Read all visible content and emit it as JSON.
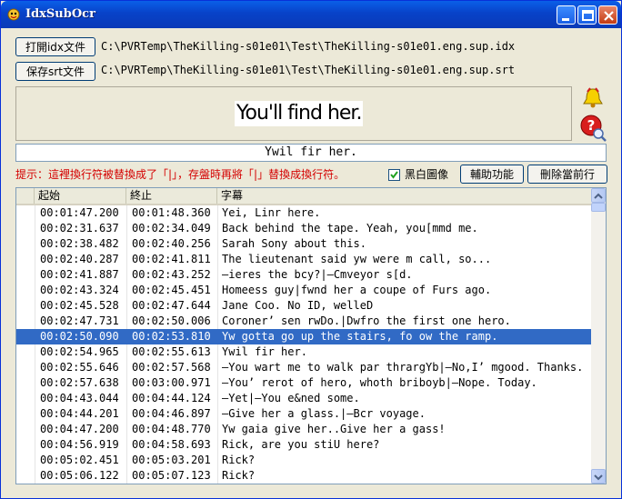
{
  "window": {
    "title": "IdxSubOcr"
  },
  "toolbar": {
    "open_idx_label": "打開idx文件",
    "idx_path": "C:\\PVRTemp\\TheKilling-s01e01\\Test\\TheKilling-s01e01.eng.sup.idx",
    "save_srt_label": "保存srt文件",
    "srt_path": "C:\\PVRTemp\\TheKilling-s01e01\\Test\\TheKilling-s01e01.eng.sup.srt"
  },
  "preview": {
    "image_text": "You'll find her."
  },
  "ocr": {
    "current_text": "Ywil fir her."
  },
  "hint": {
    "text": "提示：這裡換行符被替換成了「|」，存盤時再將「|」替換成換行符。"
  },
  "options": {
    "bw_image_label": "黑白圖像",
    "bw_checked": true
  },
  "actions": {
    "assist_label": "輔助功能",
    "delete_label": "刪除當前行"
  },
  "table": {
    "columns": [
      "起始",
      "終止",
      "字幕"
    ],
    "selected_index": 8,
    "rows": [
      {
        "start": "00:01:47.200",
        "end": "00:01:48.360",
        "text": "Yei, Linr here."
      },
      {
        "start": "00:02:31.637",
        "end": "00:02:34.049",
        "text": "Back behind the tape. Yeah, you[mmd me."
      },
      {
        "start": "00:02:38.482",
        "end": "00:02:40.256",
        "text": "Sarah Sony about this."
      },
      {
        "start": "00:02:40.287",
        "end": "00:02:41.811",
        "text": "The lieutenant said yw were m call, so..."
      },
      {
        "start": "00:02:41.887",
        "end": "00:02:43.252",
        "text": "—ieres the bcy?|—Cmveyor s[d."
      },
      {
        "start": "00:02:43.324",
        "end": "00:02:45.451",
        "text": "Homeess guy|fwnd her a coupe of Furs ago."
      },
      {
        "start": "00:02:45.528",
        "end": "00:02:47.644",
        "text": "Jane Coo. No ID, welleD"
      },
      {
        "start": "00:02:47.731",
        "end": "00:02:50.006",
        "text": "Coroner’ sen rwDo.|Dwfro the first one hero."
      },
      {
        "start": "00:02:50.090",
        "end": "00:02:53.810",
        "text": "Yw gotta go up the stairs, fo ow the ramp."
      },
      {
        "start": "00:02:54.965",
        "end": "00:02:55.613",
        "text": "Ywil fir her."
      },
      {
        "start": "00:02:55.646",
        "end": "00:02:57.568",
        "text": "—You wart me to walk par thrargYb|—No,I’ mgood. Thanks."
      },
      {
        "start": "00:02:57.638",
        "end": "00:03:00.971",
        "text": "—You’ rerot of hero, whoth briboyb|—Nope. Today."
      },
      {
        "start": "00:04:43.044",
        "end": "00:04:44.124",
        "text": "—Yet|—You e&ned some."
      },
      {
        "start": "00:04:44.201",
        "end": "00:04:46.897",
        "text": "—Give her a glass.|—Bcr voyage."
      },
      {
        "start": "00:04:47.200",
        "end": "00:04:48.770",
        "text": "Yw gaia give her..Give her a gass!"
      },
      {
        "start": "00:04:56.919",
        "end": "00:04:58.693",
        "text": "Rick, are you stiU here?"
      },
      {
        "start": "00:05:02.451",
        "end": "00:05:03.201",
        "text": "Rick?"
      },
      {
        "start": "00:05:06.122",
        "end": "00:05:07.123",
        "text": "Rick?"
      }
    ]
  }
}
